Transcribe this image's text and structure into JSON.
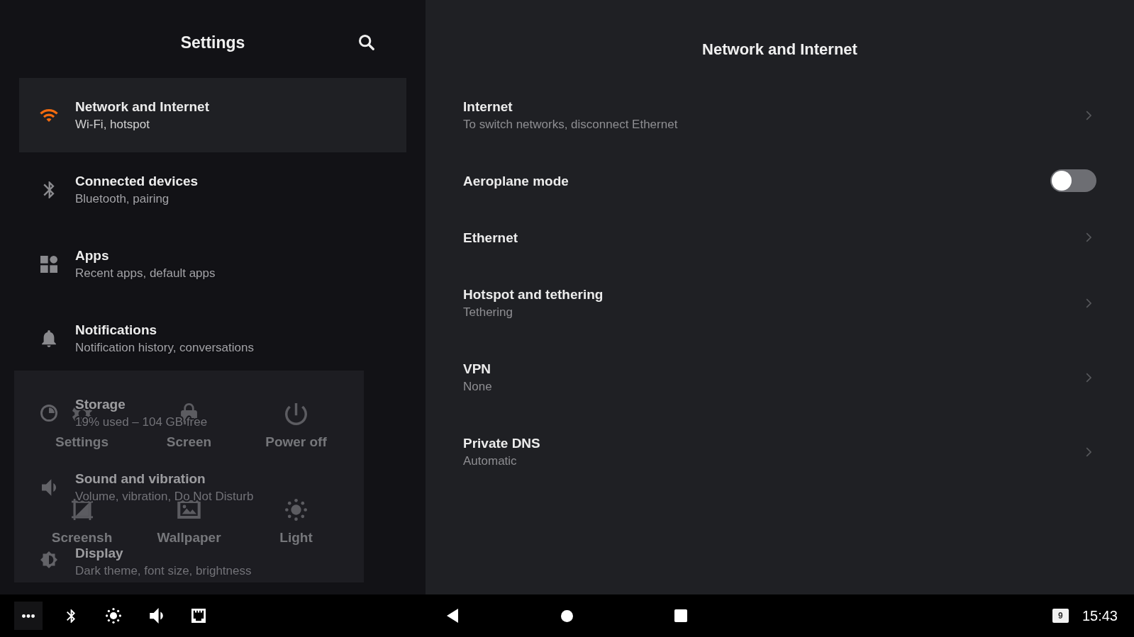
{
  "sidebar": {
    "title": "Settings",
    "items": [
      {
        "title": "Network and Internet",
        "subtitle": "Wi-Fi, hotspot",
        "selected": true
      },
      {
        "title": "Connected devices",
        "subtitle": "Bluetooth, pairing",
        "selected": false
      },
      {
        "title": "Apps",
        "subtitle": "Recent apps, default apps",
        "selected": false
      },
      {
        "title": "Notifications",
        "subtitle": "Notification history, conversations",
        "selected": false
      },
      {
        "title": "Storage",
        "subtitle": "19% used – 104 GB free",
        "selected": false
      },
      {
        "title": "Sound and vibration",
        "subtitle": "Volume, vibration, Do Not Disturb",
        "selected": false
      },
      {
        "title": "Display",
        "subtitle": "Dark theme, font size, brightness",
        "selected": false
      }
    ]
  },
  "quick_menu": {
    "items": [
      {
        "label": "Settings"
      },
      {
        "label": "Screen"
      },
      {
        "label": "Power off"
      },
      {
        "label": "Screensh"
      },
      {
        "label": "Wallpaper"
      },
      {
        "label": "Light"
      }
    ]
  },
  "detail": {
    "title": "Network and Internet",
    "rows": [
      {
        "kind": "link",
        "title": "Internet",
        "subtitle": "To switch networks, disconnect Ethernet"
      },
      {
        "kind": "toggle",
        "title": "Aeroplane mode",
        "on": false
      },
      {
        "kind": "link",
        "title": "Ethernet"
      },
      {
        "kind": "link",
        "title": "Hotspot and tethering",
        "subtitle": "Tethering"
      },
      {
        "kind": "link",
        "title": "VPN",
        "subtitle": "None"
      },
      {
        "kind": "link",
        "title": "Private DNS",
        "subtitle": "Automatic"
      }
    ]
  },
  "taskbar": {
    "notification_count": "9",
    "time": "15:43"
  }
}
